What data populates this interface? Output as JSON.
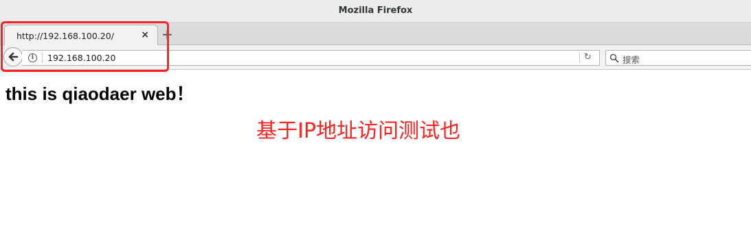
{
  "window": {
    "title": "Mozilla Firefox"
  },
  "tab": {
    "label": "http://192.168.100.20/",
    "close_glyph": "×"
  },
  "new_tab": {
    "glyph": "+"
  },
  "navbar": {
    "url": "192.168.100.20",
    "info_glyph": "i",
    "reload_glyph": "↻",
    "search_placeholder": "搜索"
  },
  "page": {
    "heading": "this is qiaodaer web！"
  },
  "annotation": {
    "text": "基于IP地址访问测试也",
    "color": "#ff2020"
  }
}
